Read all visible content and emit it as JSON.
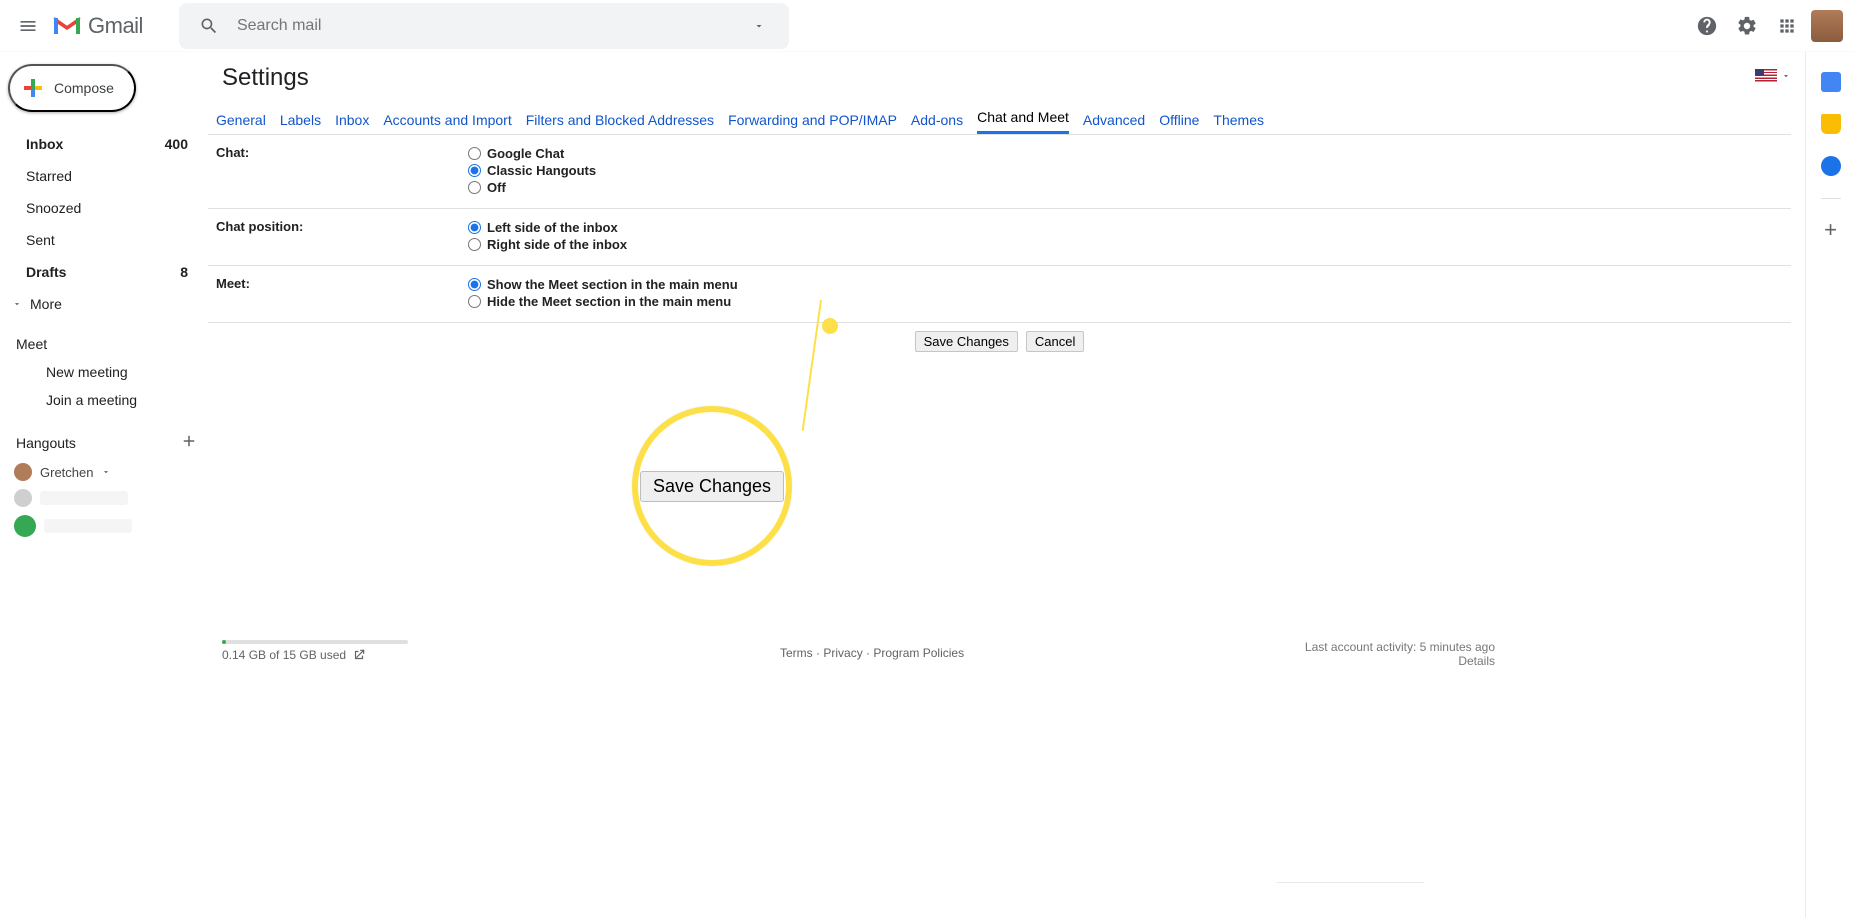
{
  "topbar": {
    "logo_text": "Gmail",
    "search_placeholder": "Search mail"
  },
  "compose_label": "Compose",
  "nav": {
    "inbox": {
      "label": "Inbox",
      "count": "400"
    },
    "starred": "Starred",
    "snoozed": "Snoozed",
    "sent": "Sent",
    "drafts": {
      "label": "Drafts",
      "count": "8"
    },
    "more": "More"
  },
  "meet_section": {
    "header": "Meet",
    "new_meeting": "New meeting",
    "join_meeting": "Join a meeting"
  },
  "hangouts_section": {
    "header": "Hangouts",
    "user": "Gretchen"
  },
  "page_title": "Settings",
  "tabs": {
    "general": "General",
    "labels": "Labels",
    "inbox": "Inbox",
    "accounts": "Accounts and Import",
    "filters": "Filters and Blocked Addresses",
    "forwarding": "Forwarding and POP/IMAP",
    "addons": "Add-ons",
    "chat_meet": "Chat and Meet",
    "advanced": "Advanced",
    "offline": "Offline",
    "themes": "Themes"
  },
  "settings": {
    "chat": {
      "label": "Chat:",
      "opt_google_chat": "Google Chat",
      "opt_classic": "Classic Hangouts",
      "opt_off": "Off"
    },
    "position": {
      "label": "Chat position:",
      "opt_left": "Left side of the inbox",
      "opt_right": "Right side of the inbox"
    },
    "meet": {
      "label": "Meet:",
      "opt_show": "Show the Meet section in the main menu",
      "opt_hide": "Hide the Meet section in the main menu"
    }
  },
  "actions": {
    "save": "Save Changes",
    "cancel": "Cancel",
    "zoom_save": "Save Changes"
  },
  "footer": {
    "terms": "Terms",
    "privacy": "Privacy",
    "policies": "Program Policies",
    "sep": "·",
    "activity": "Last account activity: 5 minutes ago",
    "details": "Details",
    "storage": "0.14 GB of 15 GB used"
  }
}
